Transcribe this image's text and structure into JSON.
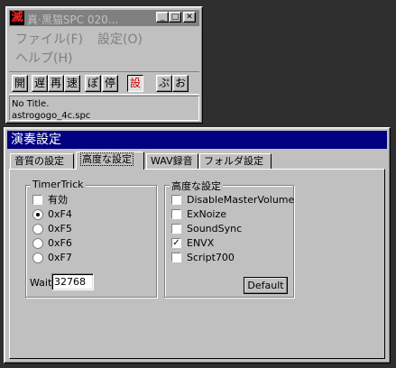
{
  "player": {
    "app_icon": "滅",
    "title": "真·黒猫SPC 020...",
    "controls": {
      "minimize": "_",
      "maximize": "□",
      "close": "✕"
    },
    "menu": [
      "ファイル(F)",
      "設定(O)"
    ],
    "menu2": [
      "ヘルプ(H)"
    ],
    "toolbar": [
      "開",
      "遅",
      "再",
      "速",
      "ぽ",
      "停",
      "設",
      "ぷ",
      "お"
    ],
    "song_title": "No Title.",
    "file_name": "astrogogo_4c.spc"
  },
  "settings": {
    "title": "演奏設定",
    "tabs": [
      "音質の設定",
      "高度な設定",
      "WAV録音",
      "フォルダ設定"
    ],
    "active_tab": "高度な設定",
    "timer_trick": {
      "title": "TimerTrick",
      "enable_label": "有効",
      "enabled": false,
      "options": [
        "0xF4",
        "0xF5",
        "0xF6",
        "0xF7"
      ],
      "selected": "0xF4",
      "wait_label": "Wait",
      "wait_value": "32768"
    },
    "advanced": {
      "title": "高度な設定",
      "options": [
        {
          "label": "DisableMasterVolume",
          "checked": false
        },
        {
          "label": "ExNoize",
          "checked": false
        },
        {
          "label": "SoundSync",
          "checked": false
        },
        {
          "label": "ENVX",
          "checked": true
        },
        {
          "label": "Script700",
          "checked": false
        }
      ],
      "default_button": "Default"
    }
  },
  "colors": {
    "desktop": "#2f2f2f",
    "face": "#c0c0c0",
    "active_title": "#000080",
    "inactive_title": "#808080",
    "highlight_text": "#d00000"
  }
}
